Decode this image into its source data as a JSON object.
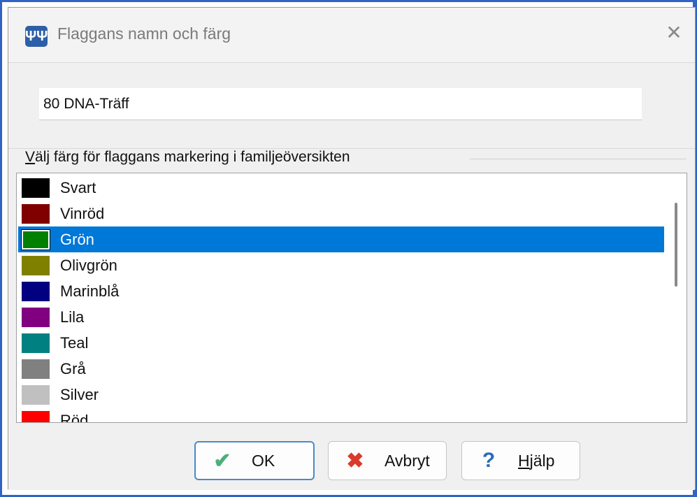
{
  "window": {
    "title": "Flaggans namn och färg",
    "close_glyph": "✕",
    "app_icon": "family-tree-icon",
    "app_icon_glyph": "ΨΨ"
  },
  "name_field": {
    "value": "80 DNA-Träff"
  },
  "color_group": {
    "label_first": "V",
    "label_rest": "älj färg för flaggans markering i familjeöversikten"
  },
  "colors": [
    {
      "label": "Svart",
      "color": "#000000",
      "selected": false
    },
    {
      "label": "Vinröd",
      "color": "#800000",
      "selected": false
    },
    {
      "label": "Grön",
      "color": "#008000",
      "selected": true
    },
    {
      "label": "Olivgrön",
      "color": "#808000",
      "selected": false
    },
    {
      "label": "Marinblå",
      "color": "#000080",
      "selected": false
    },
    {
      "label": "Lila",
      "color": "#800080",
      "selected": false
    },
    {
      "label": "Teal",
      "color": "#008080",
      "selected": false
    },
    {
      "label": "Grå",
      "color": "#808080",
      "selected": false
    },
    {
      "label": "Silver",
      "color": "#c0c0c0",
      "selected": false
    },
    {
      "label": "Röd",
      "color": "#ff0000",
      "selected": false
    }
  ],
  "buttons": {
    "ok": {
      "label": "OK",
      "icon": "checkmark-icon",
      "glyph": "✔"
    },
    "cancel": {
      "label": "Avbryt",
      "icon": "x-icon",
      "glyph": "✖"
    },
    "help": {
      "label_first": "H",
      "label_rest": "jälp",
      "icon": "question-icon",
      "glyph": "?"
    }
  },
  "accent_color": "#0078d7"
}
